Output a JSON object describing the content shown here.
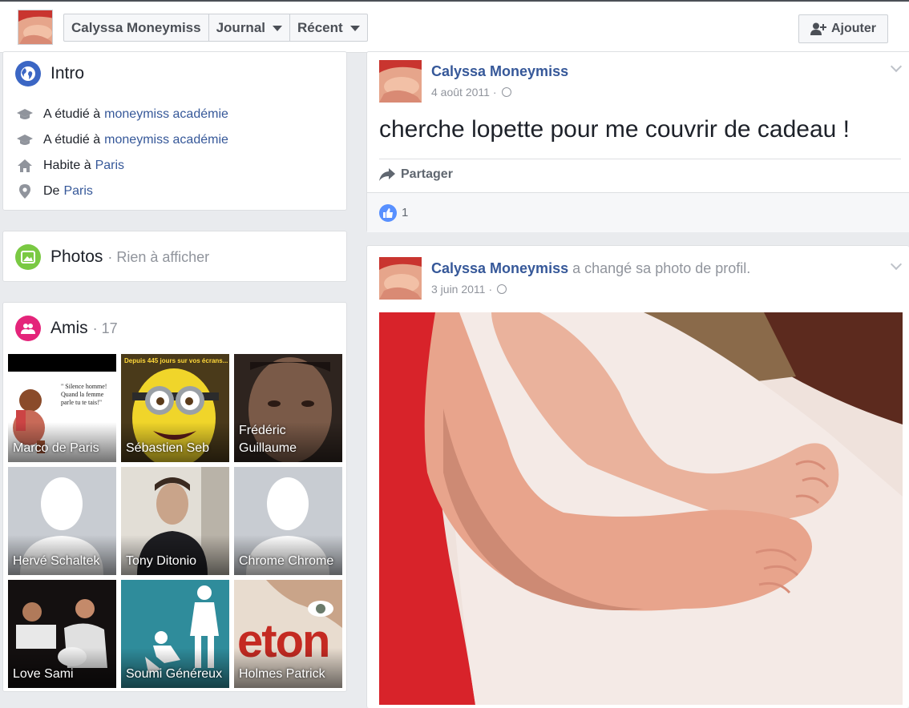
{
  "header": {
    "profile_name": "Calyssa Moneymiss",
    "journal_label": "Journal",
    "recent_label": "Récent",
    "add_label": "Ajouter"
  },
  "intro": {
    "title": "Intro",
    "items": [
      {
        "prefix": "A étudié à",
        "link": "moneymiss académie",
        "icon": "graduation-cap-icon"
      },
      {
        "prefix": "A étudié à",
        "link": "moneymiss académie",
        "icon": "graduation-cap-icon"
      },
      {
        "prefix": "Habite à",
        "link": "Paris",
        "icon": "home-icon"
      },
      {
        "prefix": "De",
        "link": "Paris",
        "icon": "location-pin-icon"
      }
    ]
  },
  "photos": {
    "title": "Photos",
    "subtitle": "· Rien à afficher"
  },
  "friends": {
    "title": "Amis",
    "count": "· 17",
    "list": [
      {
        "name": "Marco de Paris"
      },
      {
        "name": "Sébastien Seb"
      },
      {
        "name": "Frédéric Guillaume"
      },
      {
        "name": "Hervé Schaltek"
      },
      {
        "name": "Tony Ditonio"
      },
      {
        "name": "Chrome Chrome"
      },
      {
        "name": "Love Sami"
      },
      {
        "name": "Soumi Généreux"
      },
      {
        "name": "Holmes Patrick"
      }
    ],
    "thumb_texts": {
      "marco": "\" Silence homme! Quand la femme parle tu te tais!\"",
      "seb": "Depuis 445 jours sur vos écrans...",
      "holmes": "eton"
    }
  },
  "posts": [
    {
      "author": "Calyssa Moneymiss",
      "date": "4 août 2011",
      "text": "cherche lopette pour me couvrir de cadeau !",
      "share_label": "Partager",
      "likes": "1"
    },
    {
      "author": "Calyssa Moneymiss",
      "action": "a changé sa photo de profil.",
      "date": "3 juin 2011"
    }
  ],
  "colors": {
    "link": "#365899",
    "page_bg": "#e9ebee",
    "intro_icon_bg": "#3b66c4",
    "photos_icon_bg": "#7ac943",
    "friends_icon_bg": "#e4247a",
    "like_bubble": "#5890ff"
  }
}
